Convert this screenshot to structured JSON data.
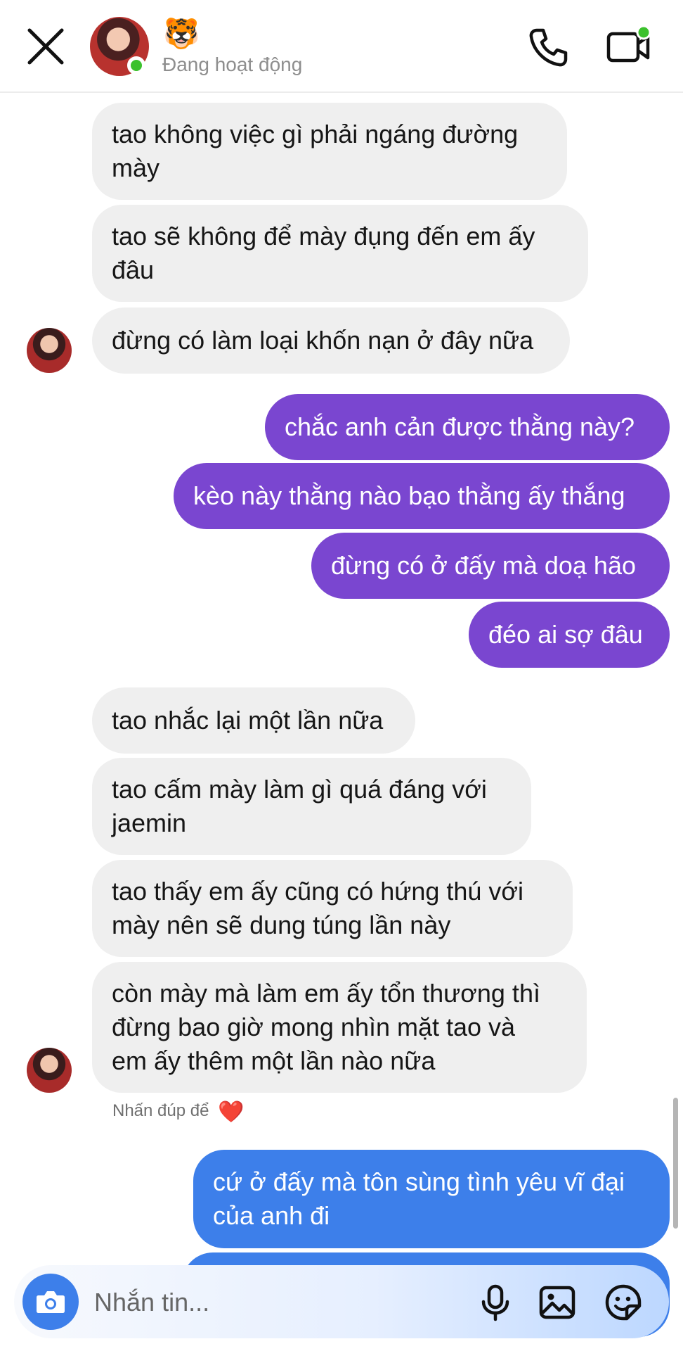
{
  "header": {
    "emoji": "🐯",
    "status": "Đang hoạt động"
  },
  "messages_in_1": [
    "tao không việc gì phải ngáng đường\nmày",
    "tao sẽ không để mày đụng đến em ấy\nđâu",
    "đừng có làm loại khốn nạn ở đây nữa"
  ],
  "messages_out_1": [
    "chắc anh cản được thằng này?",
    "kèo này thằng nào bạo thằng ấy thắng",
    "đừng có ở đấy mà doạ hão",
    "đéo ai sợ đâu"
  ],
  "messages_in_2": [
    "tao nhắc lại một lần nữa",
    "tao cấm mày làm gì quá đáng với\njaemin",
    "tao thấy em ấy cũng có hứng thú với\nmày nên sẽ dung túng lần này",
    "còn mày mà làm em ấy tổn thương thì\nđừng bao giờ mong nhìn mặt tao và\nem ấy thêm một lần nào nữa"
  ],
  "reaction_hint": "Nhấn đúp để",
  "heart": "❤️",
  "messages_out_2": [
    "cứ ở đấy mà tôn sùng tình yêu vĩ đại\ncủa anh đi"
  ],
  "composer": {
    "placeholder": "Nhắn tin..."
  },
  "colors": {
    "sent_purple": "#7a46d0",
    "sent_blue": "#3d7fea",
    "received_bubble": "#efefef",
    "online_green": "#3bc12c"
  },
  "icons": [
    "close-icon",
    "phone-icon",
    "video-call-icon",
    "camera-icon",
    "microphone-icon",
    "gallery-icon",
    "sticker-icon",
    "heart-icon"
  ]
}
